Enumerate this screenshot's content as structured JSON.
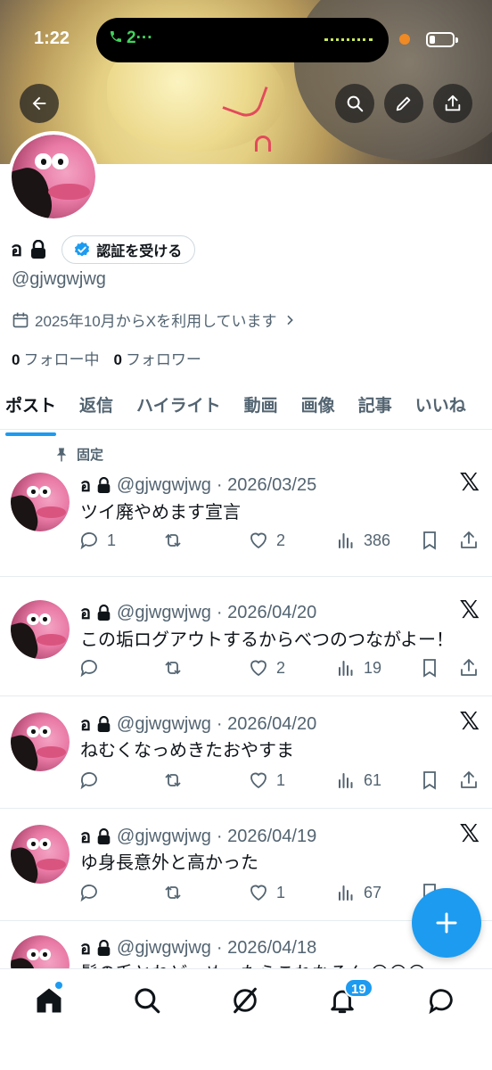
{
  "status_bar": {
    "time": "1:22",
    "call_label": "2···"
  },
  "profile": {
    "name": "อ",
    "verify_label": "認証を受ける",
    "handle": "@gjwgwjwg",
    "joined": "2025年10月からXを利用しています",
    "following_count": "0",
    "following_label": "フォロー中",
    "followers_count": "0",
    "followers_label": "フォロワー"
  },
  "tabs": [
    {
      "label": "ポスト",
      "active": true
    },
    {
      "label": "返信"
    },
    {
      "label": "ハイライト"
    },
    {
      "label": "動画"
    },
    {
      "label": "画像"
    },
    {
      "label": "記事"
    },
    {
      "label": "いいね"
    }
  ],
  "pinned_label": "固定",
  "posts": [
    {
      "name": "อ",
      "handle": "@gjwgwjwg",
      "date": "· 2026/03/25",
      "text": "ツイ廃やめます宣言",
      "replies": "1",
      "reposts": "",
      "likes": "2",
      "views": "386"
    },
    {
      "name": "อ",
      "handle": "@gjwgwjwg",
      "date": "· 2026/04/20",
      "text": "この垢ログアウトするからべつのつながよー！",
      "replies": "",
      "reposts": "",
      "likes": "2",
      "views": "19"
    },
    {
      "name": "อ",
      "handle": "@gjwgwjwg",
      "date": "· 2026/04/20",
      "text": "ねむくなっめきたおやすま",
      "replies": "",
      "reposts": "",
      "likes": "1",
      "views": "61"
    },
    {
      "name": "อ",
      "handle": "@gjwgwjwg",
      "date": "· 2026/04/19",
      "text": "ゆ身長意外と高かった",
      "replies": "",
      "reposts": "",
      "likes": "1",
      "views": "67"
    },
    {
      "name": "อ",
      "handle": "@gjwgwjwg",
      "date": "· 2026/04/18",
      "text": "髪の毛とねどーめったらこれなるん 😔😔😔"
    }
  ],
  "nav": {
    "notifications_badge": "19"
  },
  "icons": [
    "back-arrow-icon",
    "search-icon",
    "edit-icon",
    "share-icon",
    "lock-icon",
    "verified-badge-icon",
    "calendar-icon",
    "chevron-right-icon",
    "pin-icon",
    "x-logo-icon",
    "reply-icon",
    "repost-icon",
    "like-icon",
    "views-icon",
    "bookmark-icon",
    "home-icon",
    "grok-icon",
    "bell-icon",
    "messages-icon",
    "plus-icon"
  ],
  "colors": {
    "accent": "#1d9bf0",
    "secondary_text": "#536471",
    "call_green": "#41d35c"
  }
}
